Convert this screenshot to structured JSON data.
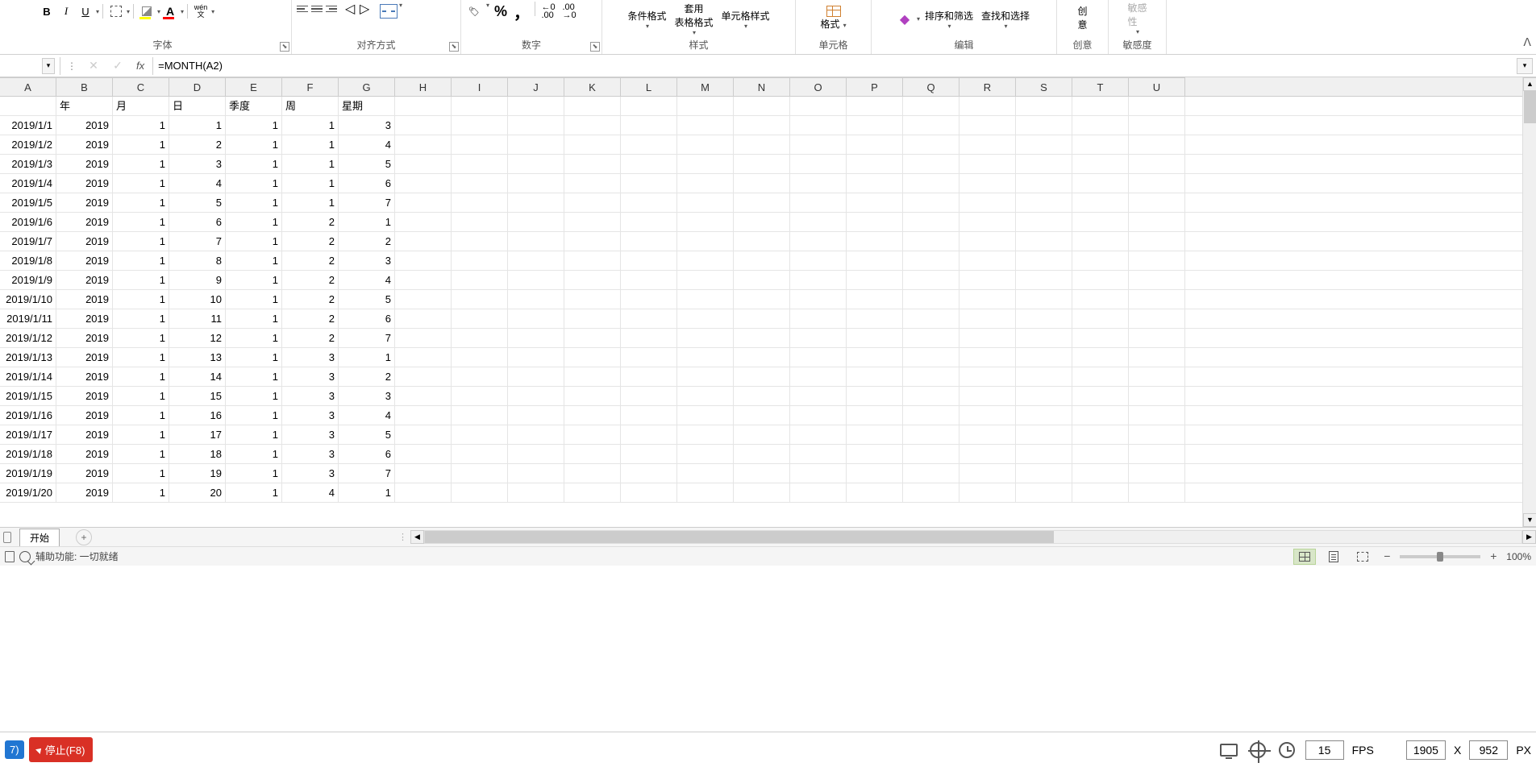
{
  "ribbon": {
    "groups": {
      "font": {
        "label": "字体",
        "bold": "B",
        "italic": "I",
        "underline": "U",
        "wen": "wén",
        "wen2": "文"
      },
      "alignment": {
        "label": "对齐方式"
      },
      "number": {
        "label": "数字",
        "percent": "%",
        "comma": "，",
        "inc_dec": "←0\n.00",
        "dec_dec": ".00\n→0"
      },
      "styles": {
        "label": "样式",
        "cond_format": "条件格式",
        "table_format": "套用\n表格格式",
        "cell_style": "单元格样式"
      },
      "cells": {
        "label": "单元格",
        "format": "格式"
      },
      "editing": {
        "label": "编辑",
        "sort_filter": "排序和筛选",
        "find_select": "查找和选择"
      },
      "ideas": {
        "label": "创意",
        "ideas_btn": "创\n意"
      },
      "sensitivity": {
        "label": "敏感度",
        "sens_btn": "敏感\n性"
      }
    }
  },
  "formula_bar": {
    "fx": "fx",
    "formula": "=MONTH(A2)"
  },
  "columns": [
    "A",
    "B",
    "C",
    "D",
    "E",
    "F",
    "G",
    "H",
    "I",
    "J",
    "K",
    "L",
    "M",
    "N",
    "O",
    "P",
    "Q",
    "R",
    "S",
    "T",
    "U"
  ],
  "headers": {
    "A": "",
    "B": "年",
    "C": "月",
    "D": "日",
    "E": "季度",
    "F": "周",
    "G": "星期"
  },
  "rows": [
    {
      "A": "2019/1/1",
      "B": "2019",
      "C": "1",
      "D": "1",
      "E": "1",
      "F": "1",
      "G": "3"
    },
    {
      "A": "2019/1/2",
      "B": "2019",
      "C": "1",
      "D": "2",
      "E": "1",
      "F": "1",
      "G": "4"
    },
    {
      "A": "2019/1/3",
      "B": "2019",
      "C": "1",
      "D": "3",
      "E": "1",
      "F": "1",
      "G": "5"
    },
    {
      "A": "2019/1/4",
      "B": "2019",
      "C": "1",
      "D": "4",
      "E": "1",
      "F": "1",
      "G": "6"
    },
    {
      "A": "2019/1/5",
      "B": "2019",
      "C": "1",
      "D": "5",
      "E": "1",
      "F": "1",
      "G": "7"
    },
    {
      "A": "2019/1/6",
      "B": "2019",
      "C": "1",
      "D": "6",
      "E": "1",
      "F": "2",
      "G": "1"
    },
    {
      "A": "2019/1/7",
      "B": "2019",
      "C": "1",
      "D": "7",
      "E": "1",
      "F": "2",
      "G": "2"
    },
    {
      "A": "2019/1/8",
      "B": "2019",
      "C": "1",
      "D": "8",
      "E": "1",
      "F": "2",
      "G": "3"
    },
    {
      "A": "2019/1/9",
      "B": "2019",
      "C": "1",
      "D": "9",
      "E": "1",
      "F": "2",
      "G": "4"
    },
    {
      "A": "2019/1/10",
      "B": "2019",
      "C": "1",
      "D": "10",
      "E": "1",
      "F": "2",
      "G": "5"
    },
    {
      "A": "2019/1/11",
      "B": "2019",
      "C": "1",
      "D": "11",
      "E": "1",
      "F": "2",
      "G": "6"
    },
    {
      "A": "2019/1/12",
      "B": "2019",
      "C": "1",
      "D": "12",
      "E": "1",
      "F": "2",
      "G": "7"
    },
    {
      "A": "2019/1/13",
      "B": "2019",
      "C": "1",
      "D": "13",
      "E": "1",
      "F": "3",
      "G": "1"
    },
    {
      "A": "2019/1/14",
      "B": "2019",
      "C": "1",
      "D": "14",
      "E": "1",
      "F": "3",
      "G": "2"
    },
    {
      "A": "2019/1/15",
      "B": "2019",
      "C": "1",
      "D": "15",
      "E": "1",
      "F": "3",
      "G": "3"
    },
    {
      "A": "2019/1/16",
      "B": "2019",
      "C": "1",
      "D": "16",
      "E": "1",
      "F": "3",
      "G": "4"
    },
    {
      "A": "2019/1/17",
      "B": "2019",
      "C": "1",
      "D": "17",
      "E": "1",
      "F": "3",
      "G": "5"
    },
    {
      "A": "2019/1/18",
      "B": "2019",
      "C": "1",
      "D": "18",
      "E": "1",
      "F": "3",
      "G": "6"
    },
    {
      "A": "2019/1/19",
      "B": "2019",
      "C": "1",
      "D": "19",
      "E": "1",
      "F": "3",
      "G": "7"
    },
    {
      "A": "2019/1/20",
      "B": "2019",
      "C": "1",
      "D": "20",
      "E": "1",
      "F": "4",
      "G": "1"
    }
  ],
  "sheet_tabs": {
    "active": "开始",
    "add": "+"
  },
  "status_bar": {
    "accessibility": "辅助功能: 一切就绪",
    "zoom": "100%"
  },
  "rec_bar": {
    "f7": "7)",
    "stop": "停止(F8)",
    "fps_val": "15",
    "fps_lbl": "FPS",
    "w": "1905",
    "x": "X",
    "h": "952",
    "px": "PX"
  }
}
